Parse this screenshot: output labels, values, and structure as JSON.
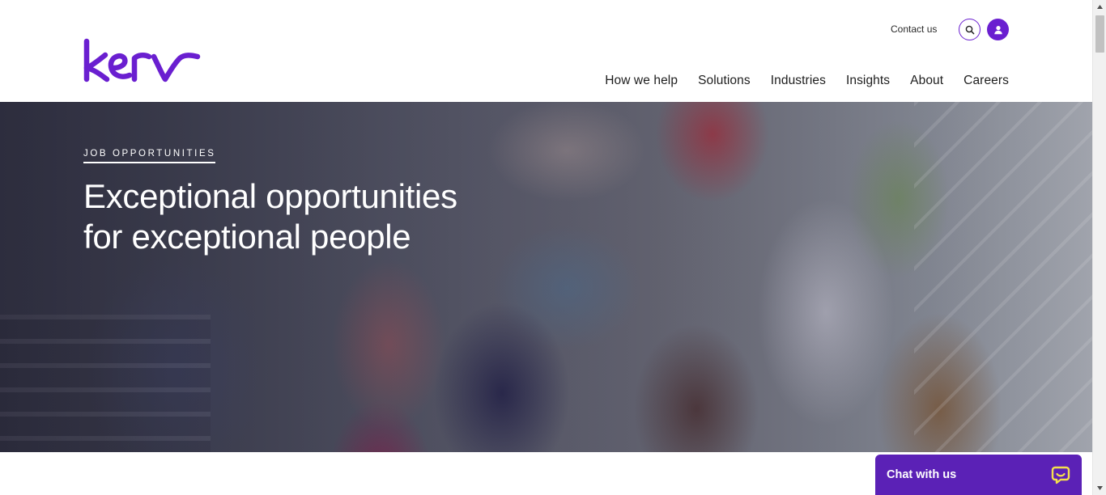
{
  "header": {
    "logo_alt": "kerv",
    "contact_label": "Contact us",
    "search_icon": "search-icon",
    "user_icon": "user-icon",
    "nav": [
      {
        "label": "How we help"
      },
      {
        "label": "Solutions"
      },
      {
        "label": "Industries"
      },
      {
        "label": "Insights"
      },
      {
        "label": "About"
      },
      {
        "label": "Careers"
      }
    ]
  },
  "hero": {
    "eyebrow": "JOB OPPORTUNITIES",
    "title": "Exceptional opportunities for exceptional people",
    "image": "group-photo"
  },
  "chat": {
    "label": "Chat with us",
    "icon": "chat-bubble-icon"
  },
  "colors": {
    "brand_purple": "#6a1fd0",
    "chat_purple": "#5b21b6",
    "chat_icon": "#f4e04d",
    "text_dark": "#1e1e1e"
  }
}
